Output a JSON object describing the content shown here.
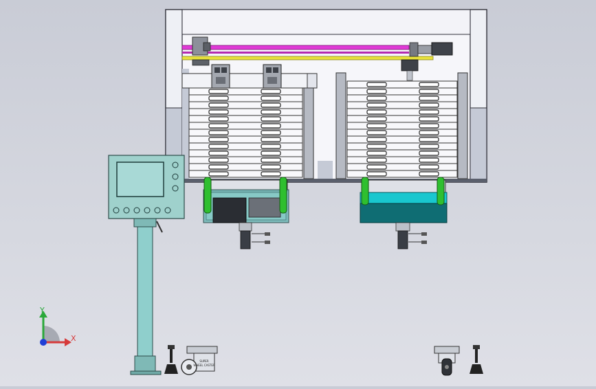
{
  "triad": {
    "y_label": "Y",
    "x_label": "X"
  },
  "caster_plate_text": "SUPER\nWHEEL CASTER",
  "colors": {
    "background": "#d3d5dd",
    "frame_fill": "#f7f7fb",
    "frame_stroke": "#3a3a44",
    "window": "#c7ccd8",
    "magenta_rail": "#e03ad6",
    "yellow_rail": "#e8e23a",
    "panel_teal": "#9fd1cc",
    "screen_teal": "#a8d9d6",
    "column_teal": "#8fcfcc",
    "green_roller": "#2fbf2f",
    "cyan_box": "#19c7cf",
    "dark_teal": "#0f6d73",
    "axis_y": "#2aa83a",
    "axis_x": "#d63a3a",
    "axis_origin": "#1f3fd6"
  },
  "icons": {
    "triad": "coordinate-triad-icon",
    "caster": "caster-wheel-icon",
    "leveling_foot": "leveling-foot-icon"
  }
}
